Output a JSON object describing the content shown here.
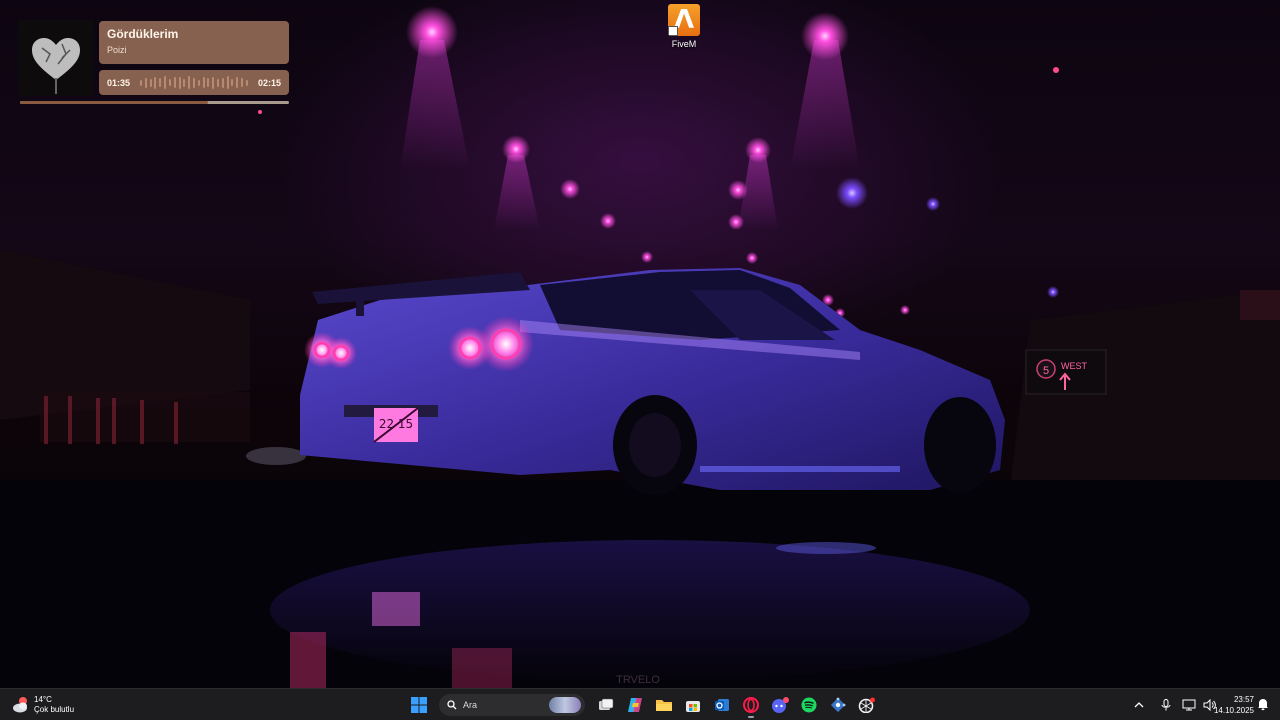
{
  "desktop": {
    "icons": [
      {
        "label": "FiveM",
        "icon": "fivem-icon",
        "color": "#f28a1e"
      }
    ]
  },
  "music_widget": {
    "title": "Gördüklerim",
    "artist": "Poizi",
    "elapsed": "01:35",
    "duration": "02:15",
    "progress": 0.7,
    "card_color": "#86614f"
  },
  "taskbar": {
    "weather": {
      "temperature": "14°C",
      "condition": "Çok bulutlu",
      "icon": "cloudy-weather-icon"
    },
    "search": {
      "placeholder": "Ara"
    },
    "apps": [
      {
        "name": "start-button",
        "icon": "windows-start-icon"
      },
      {
        "name": "task-view-button",
        "icon": "task-view-icon"
      },
      {
        "name": "copilot-button",
        "icon": "copilot-icon"
      },
      {
        "name": "file-explorer-button",
        "icon": "folder-icon"
      },
      {
        "name": "microsoft-store-button",
        "icon": "store-icon"
      },
      {
        "name": "outlook-button",
        "icon": "outlook-icon"
      },
      {
        "name": "opera-gx-button",
        "icon": "opera-gx-icon",
        "active": true
      },
      {
        "name": "discord-button",
        "icon": "discord-icon"
      },
      {
        "name": "spotify-button",
        "icon": "spotify-icon"
      },
      {
        "name": "network-app-button",
        "icon": "network-app-icon"
      },
      {
        "name": "chatgpt-button",
        "icon": "chatgpt-icon"
      }
    ],
    "tray": [
      "chevron-up-icon",
      "microphone-icon",
      "network-icon",
      "volume-icon"
    ],
    "clock": {
      "time": "23:57",
      "date": "14.10.2025"
    },
    "accent": "#0078d4"
  },
  "wallpaper": {
    "plate_text": "22 15",
    "sign_number": "5",
    "sign_text": "WEST",
    "watermark": "TRVELO",
    "colors": {
      "neon": "#ff3fd8",
      "car": "#3a2a9a",
      "glow": "#8a2bb0"
    }
  }
}
